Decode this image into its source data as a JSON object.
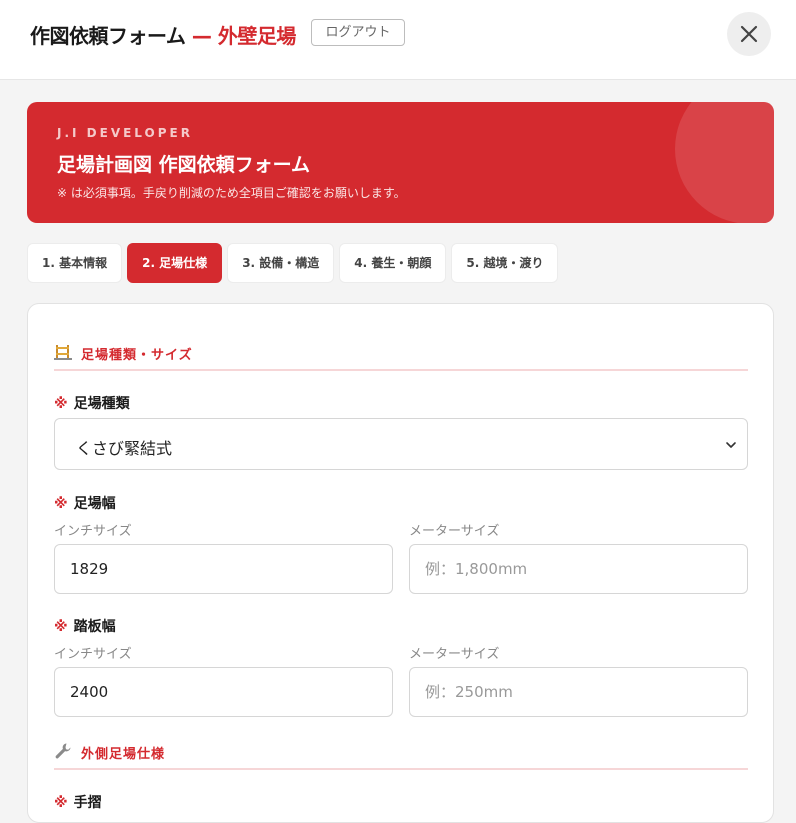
{
  "header": {
    "title_main": "作図依頼フォーム",
    "title_separator": " — ",
    "title_sub": "外壁足場",
    "logout_label": "ログアウト"
  },
  "banner": {
    "kicker": "J.I DEVELOPER",
    "heading": "足場計画図 作図依頼フォーム",
    "note": "※ は必須事項。手戻り削減のため全項目ご確認をお願いします。"
  },
  "tabs": [
    {
      "label": "1. 基本情報",
      "active": false
    },
    {
      "label": "2. 足場仕様",
      "active": true
    },
    {
      "label": "3. 設備・構造",
      "active": false
    },
    {
      "label": "4. 養生・朝顔",
      "active": false
    },
    {
      "label": "5. 越境・渡り",
      "active": false
    }
  ],
  "form": {
    "required_mark": "※",
    "section1": {
      "label": "足場種類・サイズ",
      "icon": "scaffold-icon"
    },
    "scaffold_type": {
      "label": "足場種類",
      "value": "くさび緊結式"
    },
    "scaffold_width": {
      "label": "足場幅",
      "inch_label": "インチサイズ",
      "inch_value": "1829",
      "meter_label": "メーターサイズ",
      "meter_placeholder": "例：1,800mm"
    },
    "plank_width": {
      "label": "踏板幅",
      "inch_label": "インチサイズ",
      "inch_value": "2400",
      "meter_label": "メーターサイズ",
      "meter_placeholder": "例：250mm"
    },
    "section2": {
      "label": "外側足場仕様",
      "icon": "wrench-icon"
    },
    "handrail": {
      "label": "手摺"
    }
  },
  "colors": {
    "accent": "#d42a2f",
    "accent_light": "#f6d6d7"
  }
}
